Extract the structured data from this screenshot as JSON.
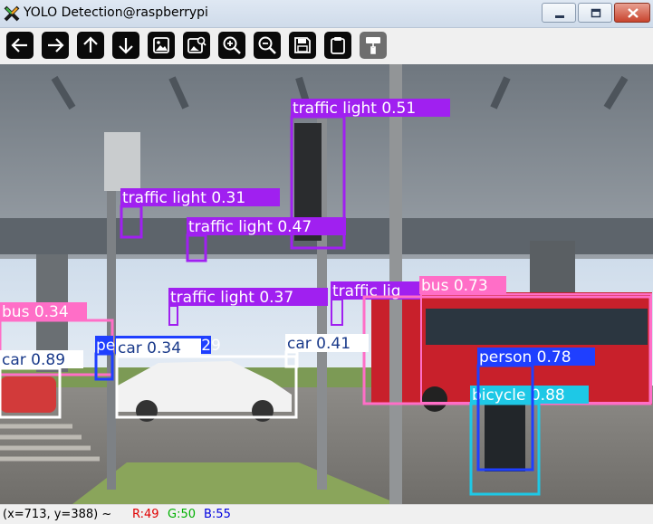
{
  "window": {
    "title": "YOLO Detection@raspberrypi",
    "app_icon": "x-logo-icon"
  },
  "toolbar": {
    "buttons": [
      {
        "name": "back-button",
        "icon": "arrow-left-icon"
      },
      {
        "name": "forward-button",
        "icon": "arrow-right-icon"
      },
      {
        "name": "pan-up-button",
        "icon": "arrow-up-icon"
      },
      {
        "name": "pan-down-button",
        "icon": "arrow-down-icon"
      },
      {
        "name": "image-button",
        "icon": "image-icon"
      },
      {
        "name": "image-search-button",
        "icon": "image-search-icon"
      },
      {
        "name": "zoom-in-button",
        "icon": "zoom-in-icon"
      },
      {
        "name": "zoom-out-button",
        "icon": "zoom-out-icon"
      },
      {
        "name": "save-button",
        "icon": "save-icon"
      },
      {
        "name": "copy-button",
        "icon": "clipboard-icon"
      },
      {
        "name": "paint-button",
        "icon": "paint-roller-icon",
        "disabled": true
      }
    ]
  },
  "detections": [
    {
      "label": "traffic light 0.51",
      "color": "#a020f0"
    },
    {
      "label": "traffic light 0.31",
      "color": "#a020f0"
    },
    {
      "label": "traffic light 0.47",
      "color": "#a020f0"
    },
    {
      "label": "traffic light 0.37",
      "color": "#a020f0"
    },
    {
      "label": "traffic lig",
      "color": "#a020f0"
    },
    {
      "label": "bus 0.73",
      "color": "#ff6ec7"
    },
    {
      "label": "bus 0.34",
      "color": "#ff6ec7"
    },
    {
      "label": "car 0.89",
      "color": "#ffffff"
    },
    {
      "label": "pe",
      "color": "#1f3fff"
    },
    {
      "label": "car 0.34",
      "color": "#ffffff"
    },
    {
      "label": "0.29",
      "color": "#1f3fff"
    },
    {
      "label": "car 0.41",
      "color": "#ffffff"
    },
    {
      "label": "person 0.78",
      "color": "#1f3fff"
    },
    {
      "label": "bicycle 0.88",
      "color": "#1ec8e6"
    }
  ],
  "status": {
    "coords": "(x=713, y=388) ~",
    "r": "R:49",
    "g": "G:50",
    "b": "B:55",
    "r_color": "#e00000",
    "g_color": "#00b000",
    "b_color": "#0000e0"
  }
}
